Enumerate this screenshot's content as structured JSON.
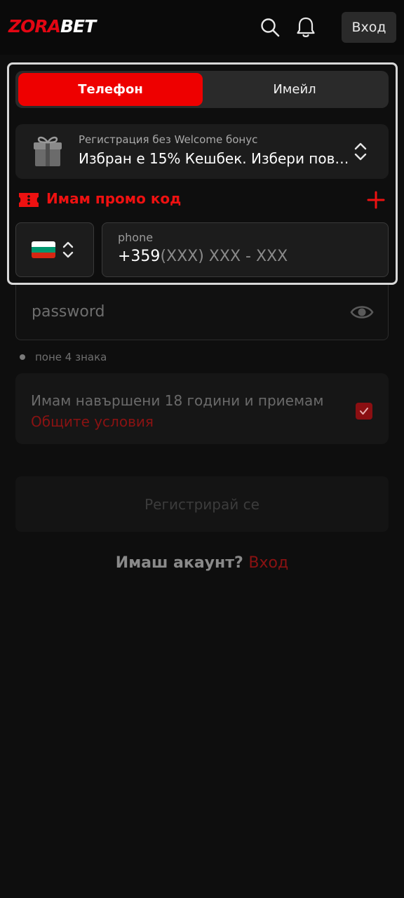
{
  "header": {
    "logo_part1": "ZORA",
    "logo_part2": "BET",
    "login_label": "Вход",
    "icons": [
      "search-icon",
      "bell-icon"
    ]
  },
  "tabs": [
    {
      "label": "Телефон",
      "active": true
    },
    {
      "label": "Имейл",
      "active": false
    }
  ],
  "bonus": {
    "subtitle": "Регистрация без Welcome бонус",
    "selected": "Избран е 15% Кешбек. Избери пове..."
  },
  "promo": {
    "label": "Имам промо код"
  },
  "phone": {
    "country": "BG",
    "label": "phone",
    "prefix": "+359",
    "mask": "(XXX) XXX - XXX"
  },
  "password": {
    "placeholder": "password",
    "hint": "поне 4 знака"
  },
  "terms": {
    "text": "Имам навършени 18 години и приемам",
    "link": "Общите условия",
    "checked": true
  },
  "register_label": "Регистрирай се",
  "account": {
    "question": "Имаш акаунт?",
    "link": "Вход"
  },
  "colors": {
    "accent": "#ee0000",
    "background": "#0e0e0e",
    "card": "#1c1c1c"
  }
}
